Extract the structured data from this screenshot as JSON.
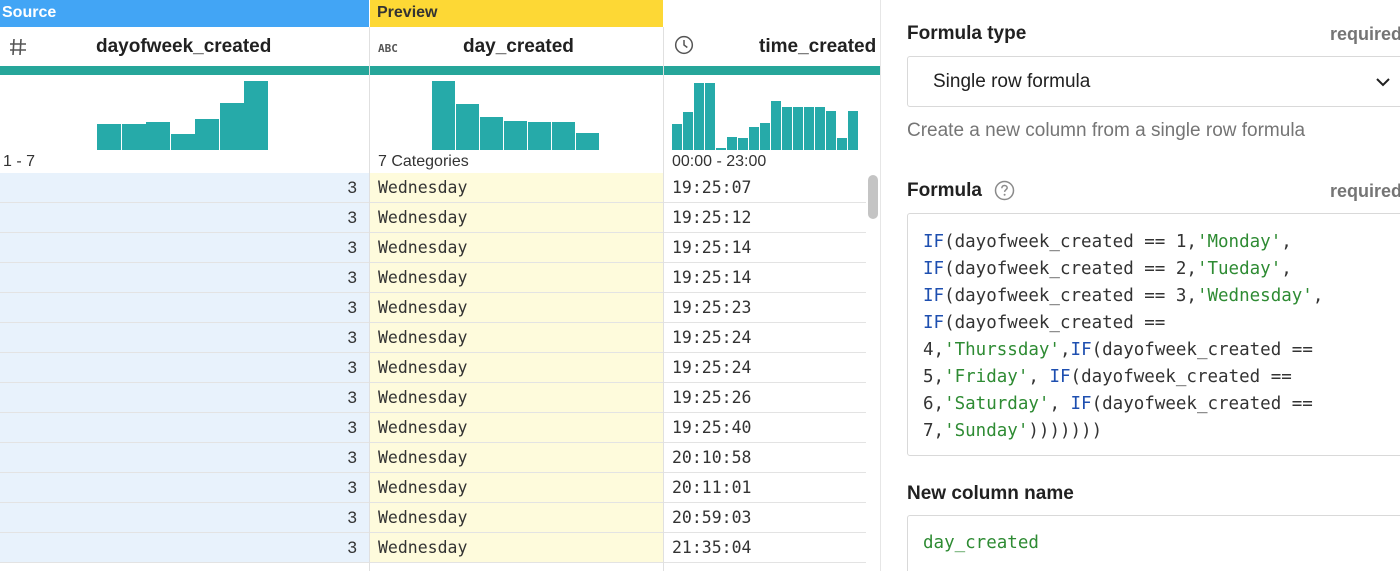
{
  "grid": {
    "source_tag": "Source",
    "preview_tag": "Preview",
    "columns": [
      {
        "name": "dayofweek_created",
        "type_icon": "hash-icon",
        "range": "1 - 7",
        "histogram": [
          0.38,
          0.38,
          0.4,
          0.23,
          0.45,
          0.68,
          1.0
        ],
        "cells": [
          "3",
          "3",
          "3",
          "3",
          "3",
          "3",
          "3",
          "3",
          "3",
          "3",
          "3",
          "3",
          "3"
        ]
      },
      {
        "name": "day_created",
        "type_icon": "abc-icon",
        "type_label": "ABC",
        "range": "7 Categories",
        "histogram": [
          1.0,
          0.67,
          0.48,
          0.42,
          0.4,
          0.4,
          0.24
        ],
        "cells": [
          "Wednesday",
          "Wednesday",
          "Wednesday",
          "Wednesday",
          "Wednesday",
          "Wednesday",
          "Wednesday",
          "Wednesday",
          "Wednesday",
          "Wednesday",
          "Wednesday",
          "Wednesday",
          "Wednesday"
        ]
      },
      {
        "name": "time_created",
        "type_icon": "clock-icon",
        "range": "00:00 - 23:00",
        "histogram": [
          0.37,
          0.55,
          0.97,
          0.97,
          0.02,
          0.19,
          0.17,
          0.34,
          0.39,
          0.71,
          0.62,
          0.62,
          0.62,
          0.62,
          0.57,
          0.17,
          0.57
        ],
        "cells": [
          "19:25:07",
          "19:25:12",
          "19:25:14",
          "19:25:14",
          "19:25:23",
          "19:25:24",
          "19:25:24",
          "19:25:26",
          "19:25:40",
          "20:10:58",
          "20:11:01",
          "20:59:03",
          "21:35:04"
        ]
      }
    ]
  },
  "panel": {
    "formula_type_label": "Formula type",
    "formula_type_required": "required",
    "formula_type_value": "Single row formula",
    "formula_type_help": "Create a new column from a single row formula",
    "formula_label": "Formula",
    "formula_required": "required",
    "formula_lines": [
      "IF(dayofweek_created == 1,'Monday',",
      "IF(dayofweek_created == 2,'Tueday',",
      "IF(dayofweek_created == 3,'Wednesday',",
      "IF(dayofweek_created ==",
      "4,'Thurssday',IF(dayofweek_created ==",
      "5,'Friday', IF(dayofweek_created ==",
      "6,'Saturday', IF(dayofweek_created ==",
      "7,'Sunday')))))))"
    ],
    "new_column_label": "New column name",
    "new_column_value": "day_created"
  },
  "colors": {
    "source": "#42a5f5",
    "preview": "#fdd835",
    "teal": "#26a69a",
    "keyword": "#1e4fb0",
    "string": "#2e8b33"
  }
}
